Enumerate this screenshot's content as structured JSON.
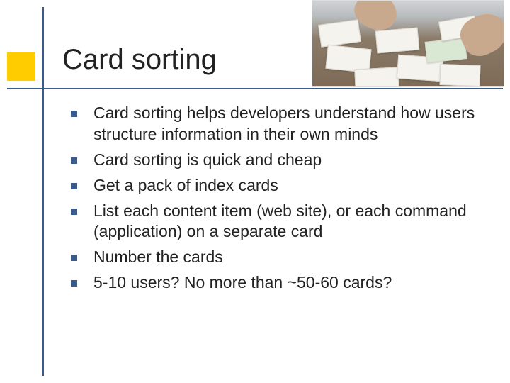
{
  "title": "Card sorting",
  "bullets": [
    "Card sorting helps developers understand how users structure information in their own minds",
    "Card sorting is quick and cheap",
    "Get a pack of index cards",
    "List each content item (web site), or each command (application) on a separate card",
    "Number the cards",
    "5-10 users? No more than ~50-60 cards?"
  ],
  "image_alt": "Hands arranging index cards on a table"
}
